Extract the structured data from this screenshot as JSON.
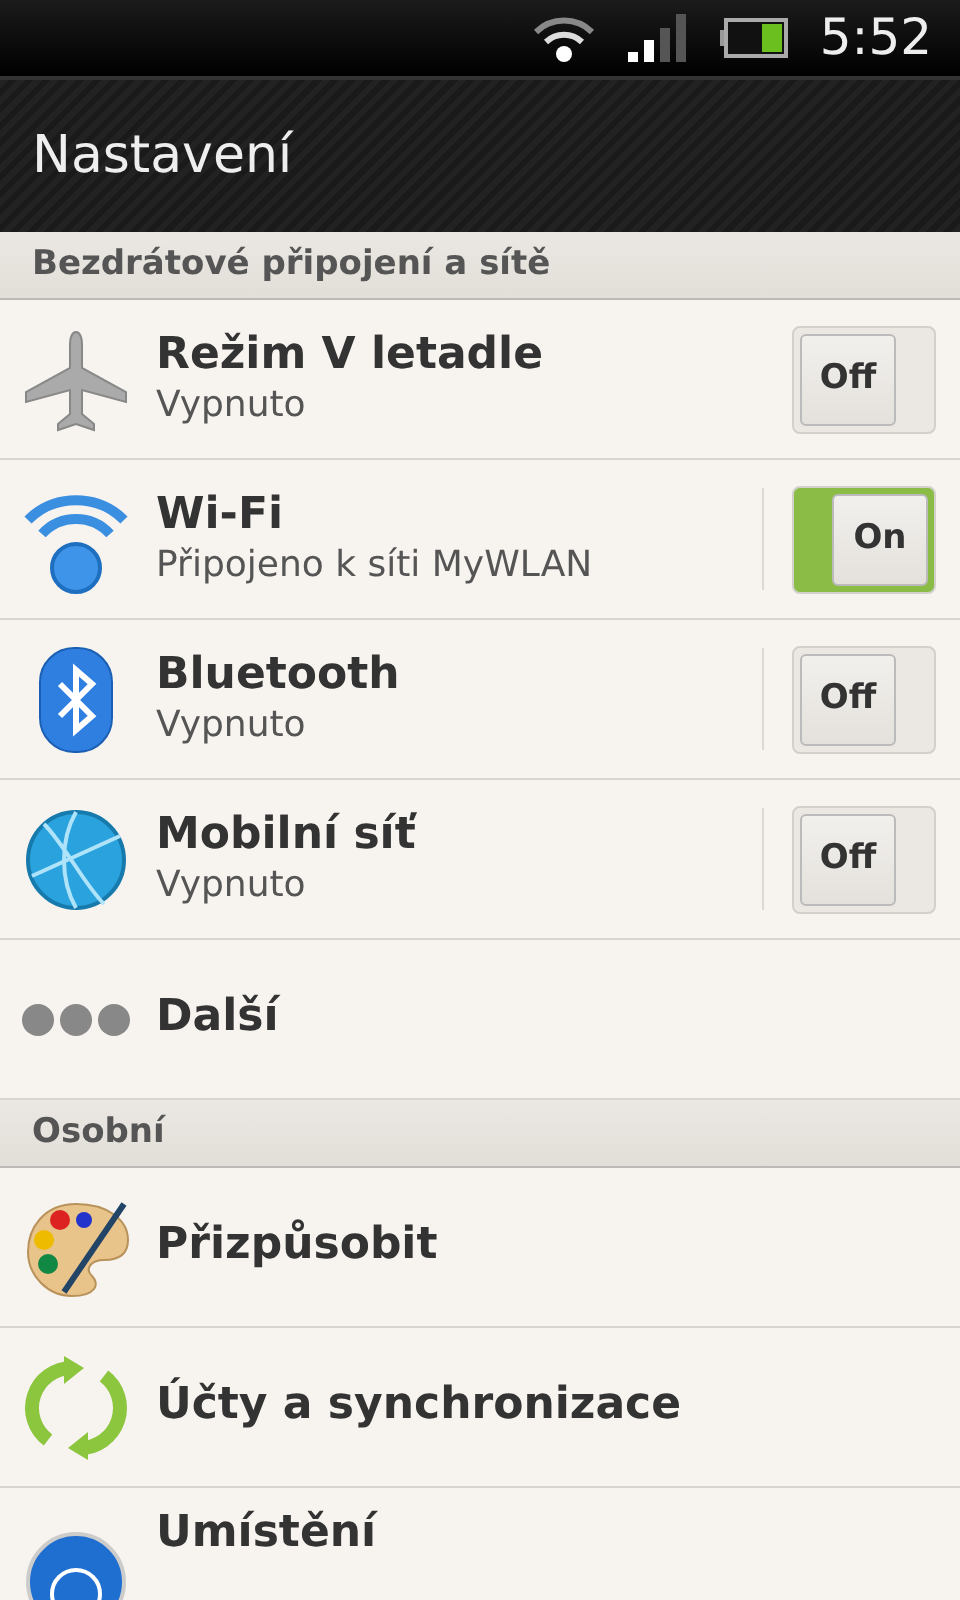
{
  "status_bar": {
    "time": "5:52"
  },
  "title": "Nastavení",
  "sections": [
    {
      "header": "Bezdrátové připojení a sítě",
      "items": [
        {
          "kind": "toggle",
          "title": "Režim V letadle",
          "subtitle": "Vypnuto",
          "on": false,
          "toggle_label": "Off",
          "separated": false
        },
        {
          "kind": "toggle",
          "title": "Wi-Fi",
          "subtitle": "Připojeno k síti MyWLAN",
          "on": true,
          "toggle_label": "On",
          "separated": true
        },
        {
          "kind": "toggle",
          "title": "Bluetooth",
          "subtitle": "Vypnuto",
          "on": false,
          "toggle_label": "Off",
          "separated": true
        },
        {
          "kind": "toggle",
          "title": "Mobilní síť",
          "subtitle": "Vypnuto",
          "on": false,
          "toggle_label": "Off",
          "separated": true
        },
        {
          "kind": "link",
          "title": "Další"
        }
      ]
    },
    {
      "header": "Osobní",
      "items": [
        {
          "kind": "link",
          "title": "Přizpůsobit"
        },
        {
          "kind": "link",
          "title": "Účty a synchronizace"
        },
        {
          "kind": "link",
          "title": "Umístění"
        }
      ]
    }
  ]
}
